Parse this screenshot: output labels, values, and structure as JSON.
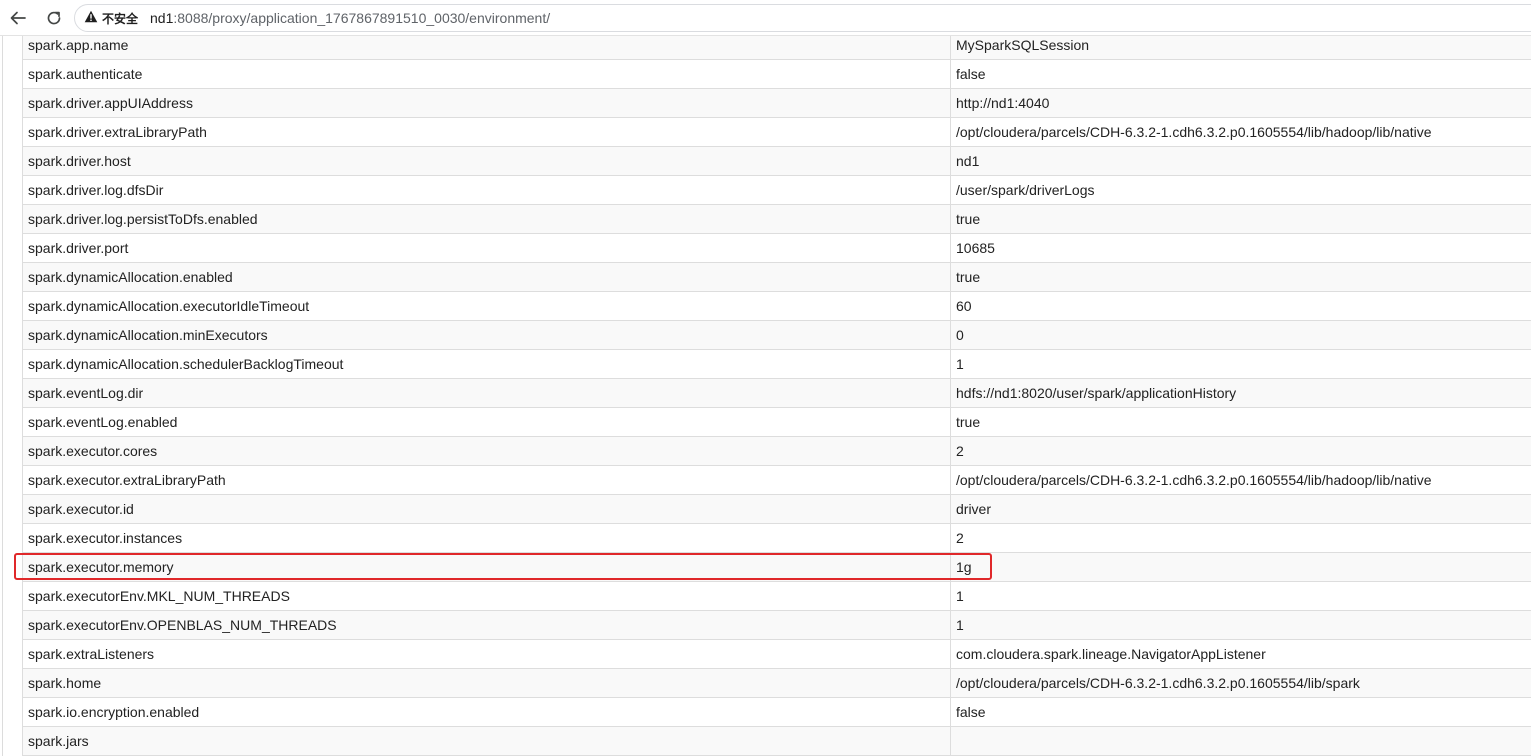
{
  "browser": {
    "security_label": "不安全",
    "url_host": "nd1",
    "url_rest": ":8088/proxy/application_1767867891510_0030/environment/"
  },
  "colors": {
    "highlight": "#e0282a",
    "row_stripe": "#f9f9f9",
    "border": "#dddddd"
  },
  "properties": [
    {
      "name": "spark.app.name",
      "value": "MySparkSQLSession"
    },
    {
      "name": "spark.authenticate",
      "value": "false"
    },
    {
      "name": "spark.driver.appUIAddress",
      "value": "http://nd1:4040"
    },
    {
      "name": "spark.driver.extraLibraryPath",
      "value": "/opt/cloudera/parcels/CDH-6.3.2-1.cdh6.3.2.p0.1605554/lib/hadoop/lib/native"
    },
    {
      "name": "spark.driver.host",
      "value": "nd1"
    },
    {
      "name": "spark.driver.log.dfsDir",
      "value": "/user/spark/driverLogs"
    },
    {
      "name": "spark.driver.log.persistToDfs.enabled",
      "value": "true"
    },
    {
      "name": "spark.driver.port",
      "value": "10685"
    },
    {
      "name": "spark.dynamicAllocation.enabled",
      "value": "true"
    },
    {
      "name": "spark.dynamicAllocation.executorIdleTimeout",
      "value": "60"
    },
    {
      "name": "spark.dynamicAllocation.minExecutors",
      "value": "0"
    },
    {
      "name": "spark.dynamicAllocation.schedulerBacklogTimeout",
      "value": "1"
    },
    {
      "name": "spark.eventLog.dir",
      "value": "hdfs://nd1:8020/user/spark/applicationHistory"
    },
    {
      "name": "spark.eventLog.enabled",
      "value": "true"
    },
    {
      "name": "spark.executor.cores",
      "value": "2"
    },
    {
      "name": "spark.executor.extraLibraryPath",
      "value": "/opt/cloudera/parcels/CDH-6.3.2-1.cdh6.3.2.p0.1605554/lib/hadoop/lib/native"
    },
    {
      "name": "spark.executor.id",
      "value": "driver"
    },
    {
      "name": "spark.executor.instances",
      "value": "2"
    },
    {
      "name": "spark.executor.memory",
      "value": "1g"
    },
    {
      "name": "spark.executorEnv.MKL_NUM_THREADS",
      "value": "1"
    },
    {
      "name": "spark.executorEnv.OPENBLAS_NUM_THREADS",
      "value": "1"
    },
    {
      "name": "spark.extraListeners",
      "value": "com.cloudera.spark.lineage.NavigatorAppListener"
    },
    {
      "name": "spark.home",
      "value": "/opt/cloudera/parcels/CDH-6.3.2-1.cdh6.3.2.p0.1605554/lib/spark"
    },
    {
      "name": "spark.io.encryption.enabled",
      "value": "false"
    },
    {
      "name": "spark.jars",
      "value": ""
    }
  ]
}
